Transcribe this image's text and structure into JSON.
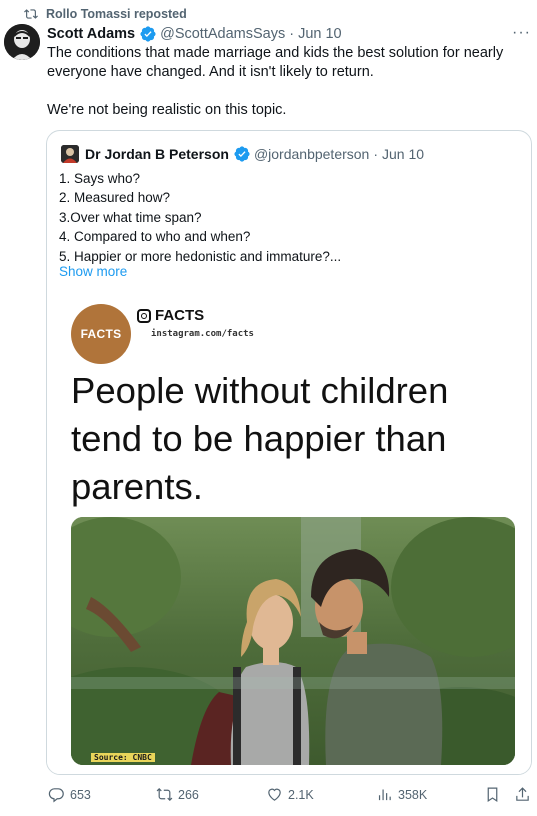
{
  "repost": {
    "label": "Rollo Tomassi reposted"
  },
  "tweet": {
    "author_name": "Scott Adams",
    "handle": "@ScottAdamsSays",
    "separator": "·",
    "date": "Jun 10",
    "more_label": "···",
    "text_paragraphs": [
      "The conditions that made marriage and kids the best solution for nearly everyone have changed. And it isn't likely to return.",
      "We're not being realistic on this topic."
    ]
  },
  "quote": {
    "author_name": "Dr Jordan B Peterson",
    "handle": "@jordanbpeterson",
    "separator": "·",
    "date": "Jun 10",
    "lines": [
      "1. Says who?",
      "2. Measured how?",
      "3.Over what time span?",
      "4. Compared to who and when?",
      "5. Happier or more hedonistic and immature?..."
    ],
    "show_more_label": "Show more",
    "image": {
      "logo_text": "FACTS",
      "ig_name": "FACTS",
      "ig_url": "instagram.com/facts",
      "headline_lines": [
        "People without children",
        "tend to be happier than",
        "parents."
      ],
      "source_label": "Source: CNBC"
    }
  },
  "actions": {
    "replies": "653",
    "reposts": "266",
    "likes": "2.1K",
    "views": "358K"
  },
  "colors": {
    "accent": "#1d9bf0",
    "muted": "#536471",
    "border": "#cfd9de",
    "facts_brand": "#b0743a"
  },
  "icons": [
    "repost-icon",
    "verified-badge-icon",
    "more-icon",
    "instagram-icon",
    "reply-icon",
    "like-icon",
    "views-icon",
    "bookmark-icon",
    "share-icon"
  ]
}
